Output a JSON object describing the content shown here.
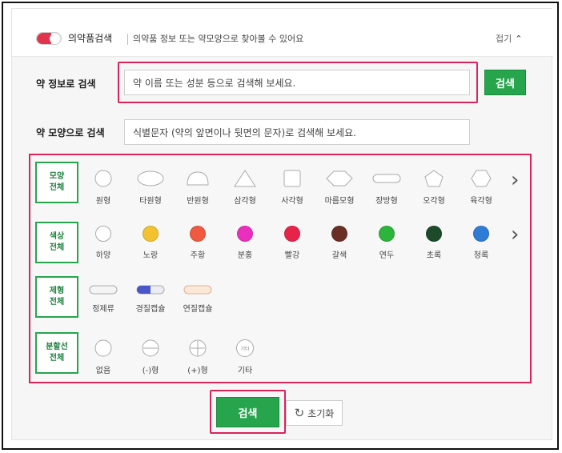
{
  "header": {
    "title": "의약품검색",
    "description": "의약품 정보 또는 약모양으로 찾아볼 수 있어요",
    "fold_label": "접기",
    "fold_icon": "chevron-up-icon"
  },
  "search_by_info": {
    "label": "약 정보로 검색",
    "placeholder": "약 이름 또는 성분 등으로 검색해 보세요.",
    "button": "검색"
  },
  "search_by_shape": {
    "label": "약 모양으로 검색",
    "placeholder": "식별문자 (약의 앞면이나 뒷면의 문자)로 검색해 보세요."
  },
  "filters": {
    "shape": {
      "category": [
        "모양",
        "전체"
      ],
      "options": [
        "원형",
        "타원형",
        "반원형",
        "삼각형",
        "사각형",
        "마름모형",
        "장방형",
        "오각형",
        "육각형"
      ]
    },
    "color": {
      "category": [
        "색상",
        "전체"
      ],
      "options": [
        {
          "label": "하양",
          "color": "#ffffff"
        },
        {
          "label": "노랑",
          "color": "#f2c230"
        },
        {
          "label": "주황",
          "color": "#ef5a40"
        },
        {
          "label": "분홍",
          "color": "#ea2fbe"
        },
        {
          "label": "빨강",
          "color": "#e8234a"
        },
        {
          "label": "갈색",
          "color": "#6a2e25"
        },
        {
          "label": "연두",
          "color": "#2cb53b"
        },
        {
          "label": "초록",
          "color": "#1d4a2a"
        },
        {
          "label": "청록",
          "color": "#2f7cd6"
        }
      ]
    },
    "form": {
      "category": [
        "제형",
        "전체"
      ],
      "options": [
        "정제류",
        "경질캡슐",
        "연질캡슐"
      ]
    },
    "score_line": {
      "category": [
        "분할선",
        "전체"
      ],
      "options": [
        "없음",
        "(-)형",
        "(+)형",
        "기타"
      ],
      "other_icon_text": "기타"
    }
  },
  "footer": {
    "search_button": "검색",
    "reset_button": "초기화",
    "reset_icon": "refresh-icon"
  },
  "colors": {
    "accent_green": "#27a54d",
    "highlight": "#d9245a"
  }
}
